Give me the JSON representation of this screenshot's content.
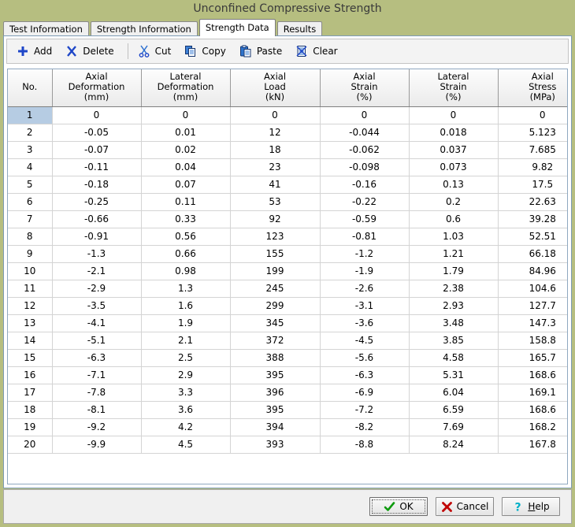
{
  "window": {
    "title": "Unconfined Compressive Strength"
  },
  "tabs": [
    {
      "label": "Test Information",
      "active": false
    },
    {
      "label": "Strength Information",
      "active": false
    },
    {
      "label": "Strength Data",
      "active": true
    },
    {
      "label": "Results",
      "active": false
    }
  ],
  "toolbar": {
    "add_label": "Add",
    "delete_label": "Delete",
    "cut_label": "Cut",
    "copy_label": "Copy",
    "paste_label": "Paste",
    "clear_label": "Clear"
  },
  "grid": {
    "columns": [
      {
        "line1": "No.",
        "line2": "",
        "line3": ""
      },
      {
        "line1": "Axial",
        "line2": "Deformation",
        "line3": "(mm)"
      },
      {
        "line1": "Lateral",
        "line2": "Deformation",
        "line3": "(mm)"
      },
      {
        "line1": "Axial",
        "line2": "Load",
        "line3": "(kN)"
      },
      {
        "line1": "Axial",
        "line2": "Strain",
        "line3": "(%)"
      },
      {
        "line1": "Lateral",
        "line2": "Strain",
        "line3": "(%)"
      },
      {
        "line1": "Axial",
        "line2": "Stress",
        "line3": "(MPa)"
      }
    ],
    "selected_row": 1,
    "rows": [
      {
        "no": "1",
        "axial_deformation": "0",
        "lateral_deformation": "0",
        "axial_load": "0",
        "axial_strain": "0",
        "lateral_strain": "0",
        "axial_stress": "0"
      },
      {
        "no": "2",
        "axial_deformation": "-0.05",
        "lateral_deformation": "0.01",
        "axial_load": "12",
        "axial_strain": "-0.044",
        "lateral_strain": "0.018",
        "axial_stress": "5.123"
      },
      {
        "no": "3",
        "axial_deformation": "-0.07",
        "lateral_deformation": "0.02",
        "axial_load": "18",
        "axial_strain": "-0.062",
        "lateral_strain": "0.037",
        "axial_stress": "7.685"
      },
      {
        "no": "4",
        "axial_deformation": "-0.11",
        "lateral_deformation": "0.04",
        "axial_load": "23",
        "axial_strain": "-0.098",
        "lateral_strain": "0.073",
        "axial_stress": "9.82"
      },
      {
        "no": "5",
        "axial_deformation": "-0.18",
        "lateral_deformation": "0.07",
        "axial_load": "41",
        "axial_strain": "-0.16",
        "lateral_strain": "0.13",
        "axial_stress": "17.5"
      },
      {
        "no": "6",
        "axial_deformation": "-0.25",
        "lateral_deformation": "0.11",
        "axial_load": "53",
        "axial_strain": "-0.22",
        "lateral_strain": "0.2",
        "axial_stress": "22.63"
      },
      {
        "no": "7",
        "axial_deformation": "-0.66",
        "lateral_deformation": "0.33",
        "axial_load": "92",
        "axial_strain": "-0.59",
        "lateral_strain": "0.6",
        "axial_stress": "39.28"
      },
      {
        "no": "8",
        "axial_deformation": "-0.91",
        "lateral_deformation": "0.56",
        "axial_load": "123",
        "axial_strain": "-0.81",
        "lateral_strain": "1.03",
        "axial_stress": "52.51"
      },
      {
        "no": "9",
        "axial_deformation": "-1.3",
        "lateral_deformation": "0.66",
        "axial_load": "155",
        "axial_strain": "-1.2",
        "lateral_strain": "1.21",
        "axial_stress": "66.18"
      },
      {
        "no": "10",
        "axial_deformation": "-2.1",
        "lateral_deformation": "0.98",
        "axial_load": "199",
        "axial_strain": "-1.9",
        "lateral_strain": "1.79",
        "axial_stress": "84.96"
      },
      {
        "no": "11",
        "axial_deformation": "-2.9",
        "lateral_deformation": "1.3",
        "axial_load": "245",
        "axial_strain": "-2.6",
        "lateral_strain": "2.38",
        "axial_stress": "104.6"
      },
      {
        "no": "12",
        "axial_deformation": "-3.5",
        "lateral_deformation": "1.6",
        "axial_load": "299",
        "axial_strain": "-3.1",
        "lateral_strain": "2.93",
        "axial_stress": "127.7"
      },
      {
        "no": "13",
        "axial_deformation": "-4.1",
        "lateral_deformation": "1.9",
        "axial_load": "345",
        "axial_strain": "-3.6",
        "lateral_strain": "3.48",
        "axial_stress": "147.3"
      },
      {
        "no": "14",
        "axial_deformation": "-5.1",
        "lateral_deformation": "2.1",
        "axial_load": "372",
        "axial_strain": "-4.5",
        "lateral_strain": "3.85",
        "axial_stress": "158.8"
      },
      {
        "no": "15",
        "axial_deformation": "-6.3",
        "lateral_deformation": "2.5",
        "axial_load": "388",
        "axial_strain": "-5.6",
        "lateral_strain": "4.58",
        "axial_stress": "165.7"
      },
      {
        "no": "16",
        "axial_deformation": "-7.1",
        "lateral_deformation": "2.9",
        "axial_load": "395",
        "axial_strain": "-6.3",
        "lateral_strain": "5.31",
        "axial_stress": "168.6"
      },
      {
        "no": "17",
        "axial_deformation": "-7.8",
        "lateral_deformation": "3.3",
        "axial_load": "396",
        "axial_strain": "-6.9",
        "lateral_strain": "6.04",
        "axial_stress": "169.1"
      },
      {
        "no": "18",
        "axial_deformation": "-8.1",
        "lateral_deformation": "3.6",
        "axial_load": "395",
        "axial_strain": "-7.2",
        "lateral_strain": "6.59",
        "axial_stress": "168.6"
      },
      {
        "no": "19",
        "axial_deformation": "-9.2",
        "lateral_deformation": "4.2",
        "axial_load": "394",
        "axial_strain": "-8.2",
        "lateral_strain": "7.69",
        "axial_stress": "168.2"
      },
      {
        "no": "20",
        "axial_deformation": "-9.9",
        "lateral_deformation": "4.5",
        "axial_load": "393",
        "axial_strain": "-8.8",
        "lateral_strain": "8.24",
        "axial_stress": "167.8"
      }
    ]
  },
  "footer": {
    "ok_label": "OK",
    "cancel_label": "Cancel",
    "help_label_accel": "H",
    "help_label_rest": "elp"
  },
  "colors": {
    "window_background": "#b6be80",
    "panel_background": "#ffffff",
    "calculated_cell": "#fdfde6",
    "row_header_cell": "#fcfce0",
    "selected_row_header": "#b6cce3",
    "toolbar_icon": "#1e46c8",
    "ok_icon": "#0f9b0f",
    "cancel_icon": "#c00000",
    "help_icon": "#00b0c8"
  }
}
